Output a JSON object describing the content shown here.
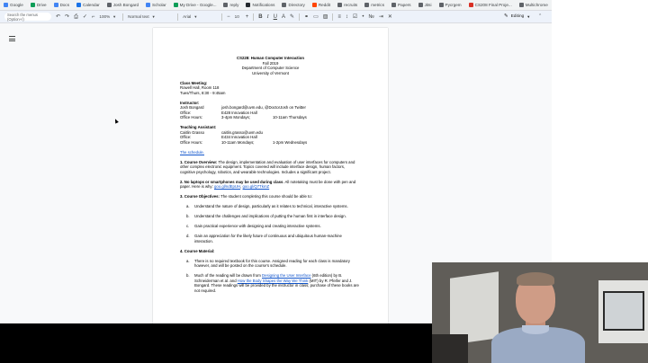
{
  "bookmarks": [
    {
      "label": "Google",
      "color": "#4285f4"
    },
    {
      "label": "Drive",
      "color": "#0f9d58"
    },
    {
      "label": "Docs",
      "color": "#4285f4"
    },
    {
      "label": "Calendar",
      "color": "#1a73e8"
    },
    {
      "label": "Josh Bongard",
      "color": "#5f6368"
    },
    {
      "label": "Scholar",
      "color": "#4285f4"
    },
    {
      "label": "My Drive - Google...",
      "color": "#0f9d58"
    },
    {
      "label": "reply",
      "color": "#5f6368"
    },
    {
      "label": "Notifications",
      "color": "#24292e"
    },
    {
      "label": "Directory",
      "color": "#5f6368"
    },
    {
      "label": "Reddit",
      "color": "#ff4500"
    },
    {
      "label": "recruits",
      "color": "#5f6368"
    },
    {
      "label": "metrics",
      "color": "#5f6368"
    },
    {
      "label": "Papers",
      "color": "#5f6368"
    },
    {
      "label": "Jitsi",
      "color": "#5f6368"
    },
    {
      "label": "Pycrgem",
      "color": "#5f6368"
    },
    {
      "label": "CS208 Final Proje...",
      "color": "#d93025"
    },
    {
      "label": "Multichrome",
      "color": "#5f6368"
    }
  ],
  "other_bookmarks": "Other Bookmarks",
  "toolbar": {
    "search_placeholder": "Search the menus (Option+/)",
    "zoom": "100%",
    "style": "Normal text",
    "font": "Arial",
    "size": "10",
    "mode": "Editing"
  },
  "doc": {
    "title": "CS228: Human Computer Interaction",
    "term": "Fall 2019",
    "dept": "Department of Computer Science",
    "univ": "University of Vermont",
    "meeting_head": "Class Meeting:",
    "meeting_room": "Rowell Hall, Room 118",
    "meeting_time": "Tues/Thurs, 8:30 - 9:45am",
    "instructor_head": "Instructor:",
    "instructor": {
      "name": "Josh Bongard",
      "contact": "josh.bongard@uvm.edu, @DoctorJosh on Twitter",
      "office_label": "Office:",
      "office": "E428 Innovation Hall",
      "hours_label": "Office Hours:",
      "hours_a": "3-4pm Mondays;",
      "hours_b": "10-11am Thursdays"
    },
    "ta_head": "Teaching Assistant:",
    "ta": {
      "name": "Caitlin Grasso",
      "contact": "caitlin.grasso@uvm.edu",
      "office_label": "Office:",
      "office": "E434 Innovation Hall",
      "hours_label": "Office Hours:",
      "hours_a": "10-11am Mondays;",
      "hours_b": "1-2pm Wednesdays"
    },
    "schedule": "The schedule.",
    "s1_head": "1. Course Overview:",
    "s1_body": " The design, implementation and evaluation of user interfaces for computers and other complex electronic equipment. Topics covered will include interface design, human factors, cognitive psychology, robotics, and wearable technologies. Includes a significant project.",
    "s2_head": "2. No laptops or smartphones may be used during class",
    "s2_body": ". All notetaking must be done with pen and paper. Here is why: ",
    "s2_link1": "goo.gl/ndEpUH",
    "s2_sep": ", ",
    "s2_link2": "goo.gl/Q7TkmZ",
    "s3_head": "3. Course Objectives:",
    "s3_body": " The student completing this course should be able to:",
    "objectives": [
      {
        "n": "a.",
        "t": "Understand the nature of design, particularly as it relates to technical, interactive systems."
      },
      {
        "n": "b.",
        "t": "Understand the challenges and implications of putting the human first in interface design."
      },
      {
        "n": "c.",
        "t": "Gain practical experience with designing and creating interactive systems."
      },
      {
        "n": "d.",
        "t": "Gain an appreciation for the likely future of continuous and ubiquitous human-machine interaction."
      }
    ],
    "s4_head": "4. Course Material:",
    "m_a_n": "a.",
    "m_a": "There is no required textbook for this course. Assigned reading for each class is mandatory however, and will be posted on the course's schedule.",
    "m_b_n": "b.",
    "m_b_1": "Much of the reading will be drawn from ",
    "m_b_link1": "Designing the User Interface",
    "m_b_2": " (6th edition) by B. Schneiderman et al. and ",
    "m_b_link2": "How the Body Shapes the Way We Think",
    "m_b_3": " (MIT) by R. Pfeifer and J. Bongard. These readings will be provided by the instructor in class; purchase of these books are not required."
  }
}
